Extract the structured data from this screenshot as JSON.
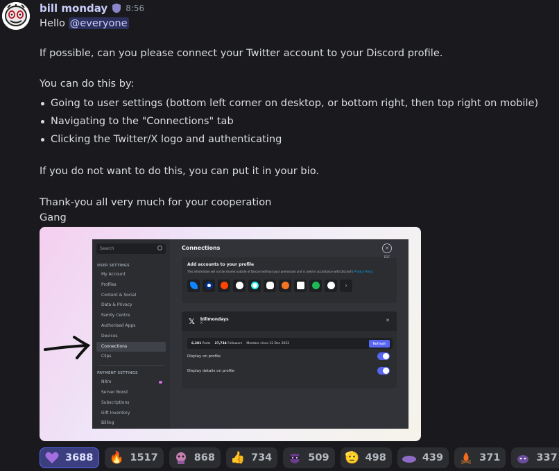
{
  "message": {
    "username": "bill monday",
    "time": "8:56",
    "greeting": "Hello ",
    "mention": "@everyone",
    "line1": "If possible, can you please connect your Twitter account to your Discord profile.",
    "line2": "You can do this by:",
    "bullets": [
      "Going to user settings (bottom left corner on desktop, or bottom right, then top right on mobile)",
      "Navigating to the \"Connections\" tab",
      "Clicking the Twitter/X logo and authenticating"
    ],
    "line3": "If you do not want to do this, you can put it in your bio.",
    "line4": "Thank-you all very much for your cooperation",
    "line5": "Gang"
  },
  "screenshot": {
    "search_placeholder": "Search",
    "user_settings_label": "USER SETTINGS",
    "user_items": [
      "My Account",
      "Profiles",
      "Content & Social",
      "Data & Privacy",
      "Family Centre",
      "Authorised Apps",
      "Devices",
      "Connections",
      "Clips"
    ],
    "payment_label": "PAYMENT SETTINGS",
    "payment_items": [
      "Nitro",
      "Server Boost",
      "Subscriptions",
      "Gift Inventory",
      "Billing"
    ],
    "title": "Connections",
    "add_heading": "Add accounts to your profile",
    "add_text": "This information will not be shared outside of Discord without your permission and is used in accordance with Discord's ",
    "add_link": "Privacy Policy.",
    "account_name": "billmondays",
    "account_type": "X",
    "posts": "6,281",
    "posts_label": "Posts",
    "followers": "27,734",
    "followers_label": "Followers",
    "member_since": "Member since 12 Dec 2022",
    "refresh_label": "Refresh",
    "display_on_profile": "Display on profile",
    "display_details": "Display details on profile",
    "esc_label": "ESC"
  },
  "reactions": [
    {
      "icon": "purple-heart-icon",
      "count": "3688",
      "selected": true
    },
    {
      "icon": "fire-icon",
      "count": "1517"
    },
    {
      "icon": "pink-creature-icon",
      "count": "868"
    },
    {
      "icon": "thumbs-up-icon",
      "count": "734"
    },
    {
      "icon": "ninja-cat-icon",
      "count": "509"
    },
    {
      "icon": "saluting-face-icon",
      "count": "498"
    },
    {
      "icon": "purple-blob-icon",
      "count": "439"
    },
    {
      "icon": "campfire-icon",
      "count": "371"
    },
    {
      "icon": "purple-creature-icon",
      "count": "337"
    }
  ],
  "colors": {
    "accent": "#5865f2",
    "username": "#c9cdfb",
    "background": "#1a1a1e"
  }
}
